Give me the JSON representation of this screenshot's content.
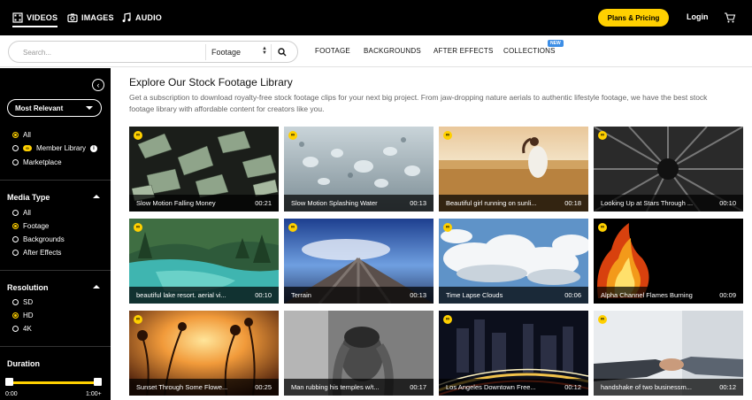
{
  "topnav": {
    "videos": "VIDEOS",
    "images": "IMAGES",
    "audio": "AUDIO",
    "plans": "Plans & Pricing",
    "login": "Login"
  },
  "search": {
    "placeholder": "Search...",
    "category": "Footage"
  },
  "catnav": {
    "footage": "FOOTAGE",
    "backgrounds": "BACKGROUNDS",
    "after_effects": "AFTER EFFECTS",
    "collections": "COLLECTIONS",
    "new_badge": "NEW"
  },
  "sidebar": {
    "sort": "Most Relevant",
    "library": {
      "all": "All",
      "member": "Member Library",
      "marketplace": "Marketplace"
    },
    "media_type": {
      "title": "Media Type",
      "all": "All",
      "footage": "Footage",
      "backgrounds": "Backgrounds",
      "after_effects": "After Effects"
    },
    "resolution": {
      "title": "Resolution",
      "sd": "SD",
      "hd": "HD",
      "k4": "4K"
    },
    "duration": {
      "title": "Duration",
      "min": "0:00",
      "max": "1:00+",
      "range": [
        0,
        1
      ]
    }
  },
  "main": {
    "title": "Explore Our Stock Footage Library",
    "description": "Get a subscription to download royalty-free stock footage clips for your next big project. From jaw-dropping nature aerials to authentic lifestyle footage, we have the best stock footage library with affordable content for creators like you."
  },
  "clips": [
    {
      "title": "Slow Motion Falling Money",
      "duration": "00:21"
    },
    {
      "title": "Slow Motion Splashing Water",
      "duration": "00:13"
    },
    {
      "title": "Beautiful girl running on sunli...",
      "duration": "00:18"
    },
    {
      "title": "Looking Up at Stars Through ...",
      "duration": "00:10"
    },
    {
      "title": "beautiful lake resort. aerial vi...",
      "duration": "00:10"
    },
    {
      "title": "Terrain",
      "duration": "00:13"
    },
    {
      "title": "Time Lapse Clouds",
      "duration": "00:06"
    },
    {
      "title": "Alpha Channel Flames Burning",
      "duration": "00:09"
    },
    {
      "title": "Sunset Through Some Flowe...",
      "duration": "00:25"
    },
    {
      "title": "Man rubbing his temples w/t...",
      "duration": "00:17"
    },
    {
      "title": "Los Angeles Downtown Free...",
      "duration": "00:12"
    },
    {
      "title": "handshake of two businessm...",
      "duration": "00:12"
    }
  ],
  "colors": {
    "accent": "#ffd000",
    "sidebar_bg": "#000000",
    "new_badge": "#3d8ee6"
  }
}
